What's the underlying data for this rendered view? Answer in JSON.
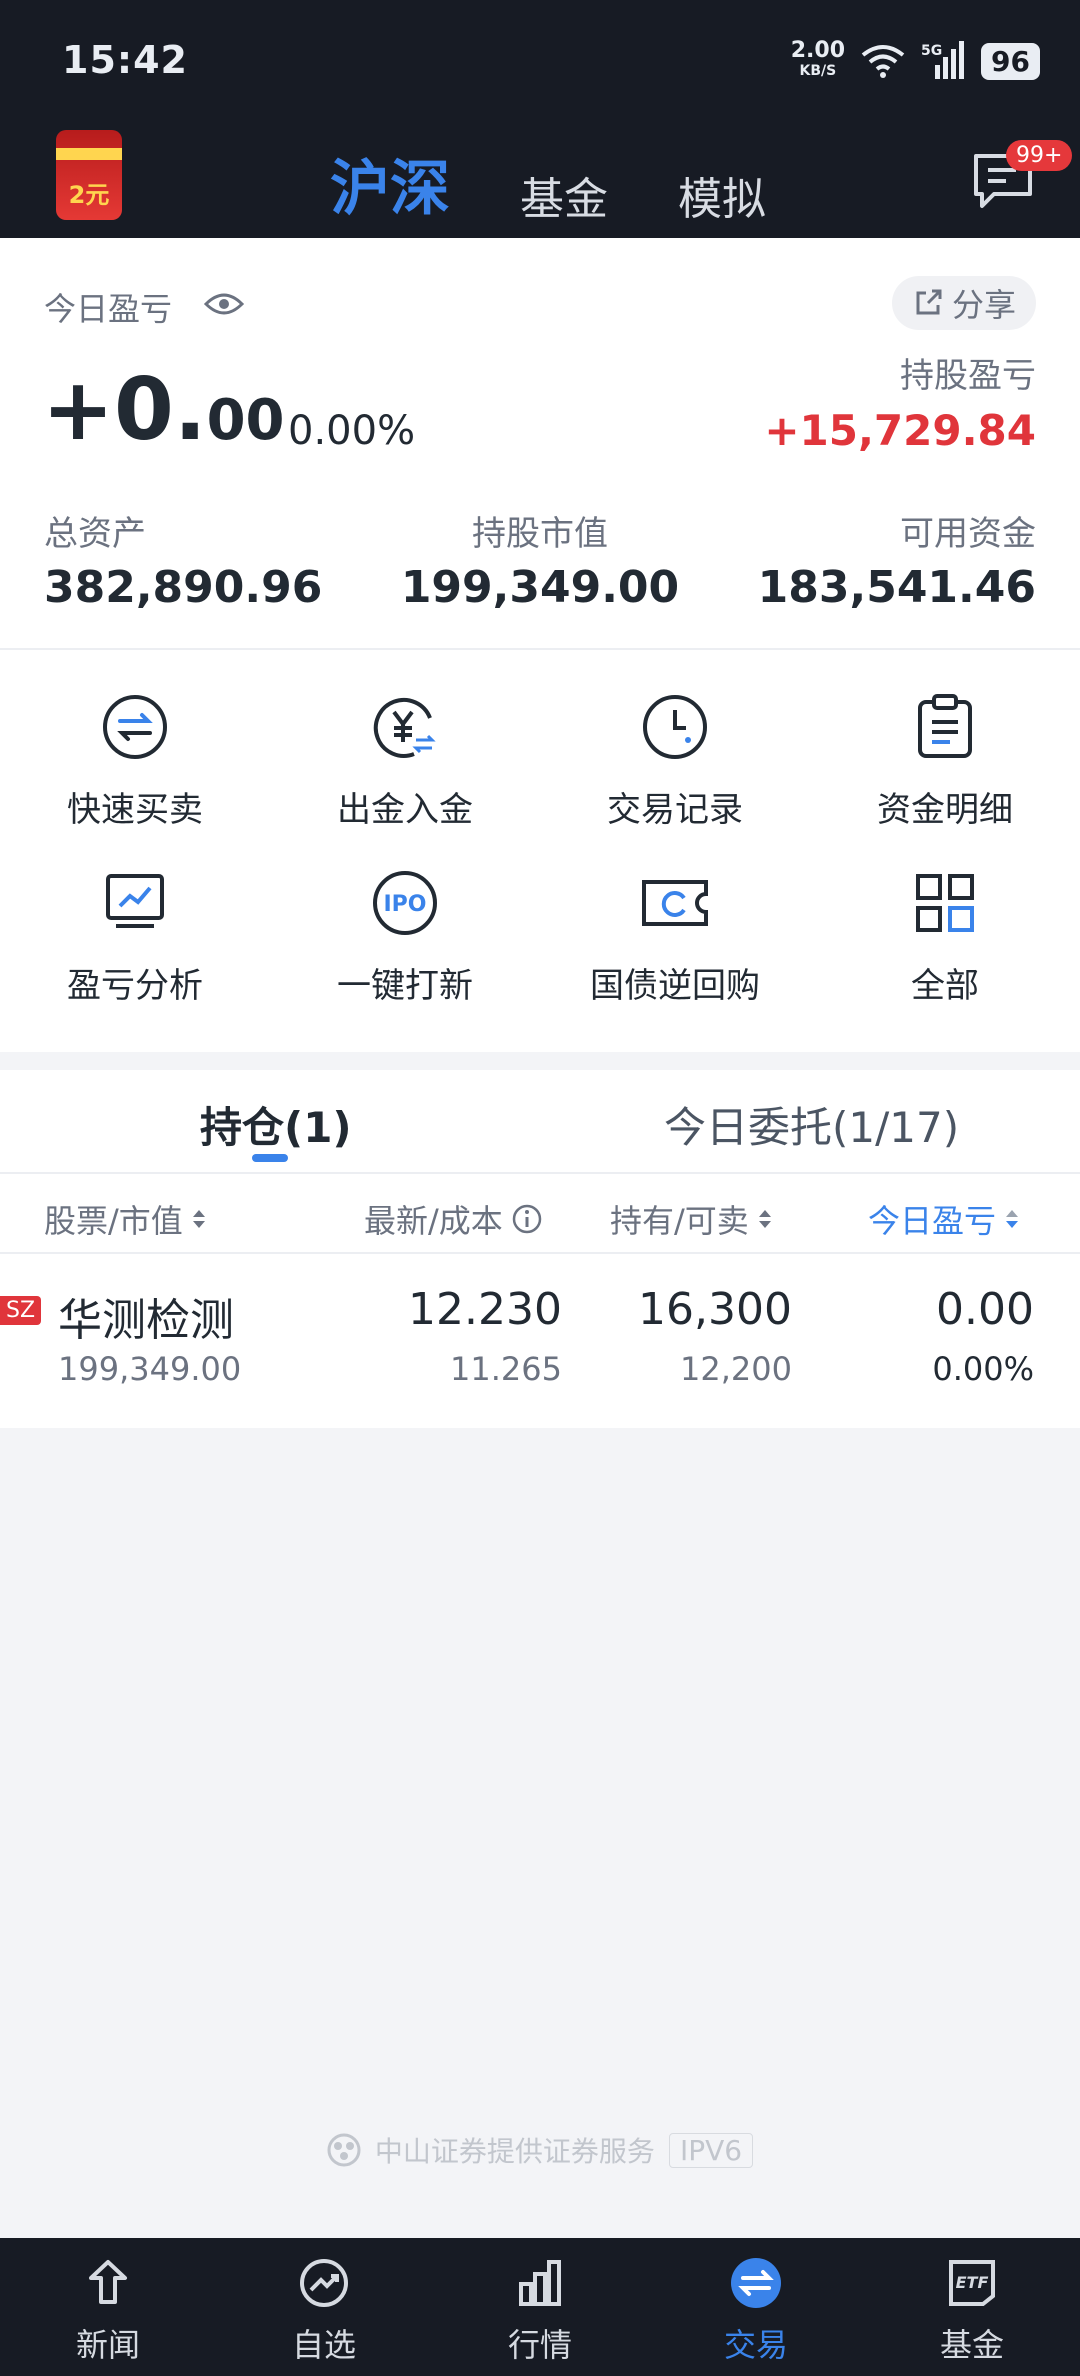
{
  "status_bar": {
    "time": "15:42",
    "speed": "2.00",
    "speed_unit": "KB/S",
    "network": "5G",
    "battery": "96"
  },
  "top_bar": {
    "avatar_text": "2元",
    "tabs": [
      {
        "label": "沪深",
        "active": true
      },
      {
        "label": "基金",
        "active": false
      },
      {
        "label": "模拟",
        "active": false
      }
    ],
    "message_badge": "99+"
  },
  "summary": {
    "today_pnl_label": "今日盈亏",
    "share_label": "分享",
    "today_pnl_int": "+0.",
    "today_pnl_dec": "00",
    "today_pnl_pct": "0.00%",
    "hold_pnl_label": "持股盈亏",
    "hold_pnl_value": "+15,729.84",
    "total_asset_label": "总资产",
    "total_asset_value": "382,890.96",
    "market_value_label": "持股市值",
    "market_value_value": "199,349.00",
    "available_label": "可用资金",
    "available_value": "183,541.46"
  },
  "quick_actions": [
    {
      "label": "快速买卖",
      "icon": "swap-icon"
    },
    {
      "label": "出金入金",
      "icon": "yuan-transfer-icon"
    },
    {
      "label": "交易记录",
      "icon": "clock-icon"
    },
    {
      "label": "资金明细",
      "icon": "clipboard-icon"
    },
    {
      "label": "盈亏分析",
      "icon": "chart-monitor-icon"
    },
    {
      "label": "一键打新",
      "icon": "ipo-icon"
    },
    {
      "label": "国债逆回购",
      "icon": "ticket-refresh-icon"
    },
    {
      "label": "全部",
      "icon": "grid-icon"
    }
  ],
  "positions": {
    "tabs": [
      {
        "label": "持仓(1)",
        "active": true
      },
      {
        "label": "今日委托(1/17)",
        "active": false
      }
    ],
    "columns": [
      "股票/市值",
      "最新/成本",
      "持有/可卖",
      "今日盈亏"
    ],
    "rows": [
      {
        "market": "SZ",
        "name": "华测检测",
        "market_value": "199,349.00",
        "latest": "12.230",
        "cost": "11.265",
        "hold": "16,300",
        "sellable": "12,200",
        "today_pnl": "0.00",
        "today_pnl_pct": "0.00%"
      }
    ]
  },
  "footer_note": {
    "text": "中山证券提供证券服务",
    "tag": "IPV6"
  },
  "bottom_nav": [
    {
      "label": "新闻",
      "icon": "news-icon",
      "active": false
    },
    {
      "label": "自选",
      "icon": "trend-icon",
      "active": false
    },
    {
      "label": "行情",
      "icon": "bar-chart-icon",
      "active": false
    },
    {
      "label": "交易",
      "icon": "trade-icon",
      "active": true
    },
    {
      "label": "基金",
      "icon": "etf-icon",
      "active": false
    }
  ],
  "colors": {
    "accent": "#3a83ea",
    "up_red": "#e0353b",
    "dark_bg": "#171b24"
  }
}
